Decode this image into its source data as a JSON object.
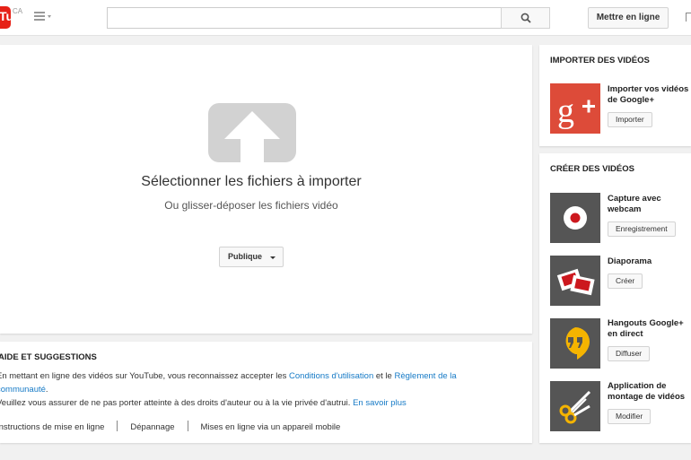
{
  "header": {
    "logo_text": "Tube",
    "region": "CA",
    "search_placeholder": "",
    "upload_label": "Mettre en ligne"
  },
  "upload": {
    "title": "Sélectionner les fichiers à importer",
    "subtitle": "Ou glisser-déposer les fichiers vidéo",
    "privacy": "Publique"
  },
  "help": {
    "title": "AIDE ET SUGGESTIONS",
    "line1_pre": "En mettant en ligne des vidéos sur YouTube, vous reconnaissez accepter les ",
    "line1_link1": "Conditions d'utilisation",
    "line1_mid": " et le ",
    "line1_link2": "Règlement de la",
    "line2_link": "communauté",
    "line2_post": ".",
    "line3_pre": "Veuillez vous assurer de ne pas porter atteinte à des droits d'auteur ou à la vie privée d'autrui. ",
    "line3_link": "En savoir plus",
    "links": [
      "Instructions de mise en ligne",
      "Dépannage",
      "Mises en ligne via un appareil mobile"
    ]
  },
  "sidebar": {
    "import_heading": "IMPORTER DES VIDÉOS",
    "import_item": {
      "title1": "Importer vos vidéos",
      "title2": "de Google+",
      "button": "Importer",
      "icon": "google-plus-icon",
      "color": "#dd4b39"
    },
    "create_heading": "CRÉER DES VIDÉOS",
    "create_items": [
      {
        "title1": "Capture avec",
        "title2": "webcam",
        "button": "Enregistrement",
        "icon": "webcam-record-icon",
        "color": "#555555"
      },
      {
        "title1": "Diaporama",
        "title2": "",
        "button": "Créer",
        "icon": "slideshow-icon",
        "color": "#555555"
      },
      {
        "title1": "Hangouts Google+",
        "title2": "en direct",
        "button": "Diffuser",
        "icon": "hangouts-icon",
        "color": "#555555"
      },
      {
        "title1": "Application de",
        "title2": "montage de vidéos",
        "button": "Modifier",
        "icon": "scissors-icon",
        "color": "#555555"
      }
    ]
  },
  "colors": {
    "brand_red": "#e62117",
    "link": "#167ac6",
    "hangouts_yellow": "#f5b400"
  }
}
